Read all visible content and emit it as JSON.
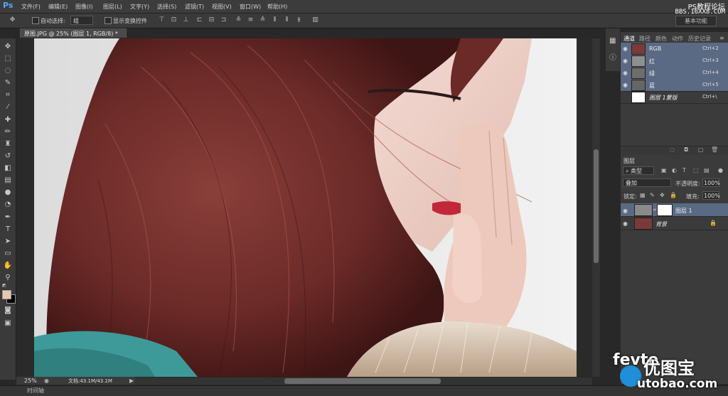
{
  "app": {
    "logo": "Ps"
  },
  "menu": [
    "文件(F)",
    "编辑(E)",
    "图像(I)",
    "图层(L)",
    "文字(Y)",
    "选择(S)",
    "滤镜(T)",
    "视图(V)",
    "窗口(W)",
    "帮助(H)"
  ],
  "site_watermark": {
    "line1": "PS教程论坛",
    "line2": "BBS.16XX8.COM"
  },
  "options": {
    "auto_select_label": "自动选择:",
    "auto_select_value": "组",
    "show_transform_label": "显示变换控件",
    "workspace_button": "基本功能"
  },
  "document": {
    "tab_title": "原图.JPG @ 25% (图层 1, RGB/8) *",
    "zoom": "25%",
    "size_info": "文档:43.1M/43.1M"
  },
  "timeline": {
    "label": "时间轴"
  },
  "channels": {
    "tabs": [
      "通道",
      "路径",
      "颜色",
      "动作",
      "历史记录"
    ],
    "rows": [
      {
        "name": "RGB",
        "shortcut": "Ctrl+2"
      },
      {
        "name": "红",
        "shortcut": "Ctrl+3"
      },
      {
        "name": "绿",
        "shortcut": "Ctrl+4"
      },
      {
        "name": "蓝",
        "shortcut": "Ctrl+5"
      },
      {
        "name": "图层 1蒙版",
        "shortcut": "Ctrl+\\"
      }
    ]
  },
  "layers": {
    "tab": "图层",
    "filter_type": "类型",
    "blend_mode": "叠加",
    "opacity_label": "不透明度:",
    "opacity_value": "100%",
    "lock_label": "锁定:",
    "fill_label": "填充:",
    "fill_value": "100%",
    "rows": [
      {
        "name": "图层 1"
      },
      {
        "name": "背景"
      }
    ]
  },
  "bottom_watermark": {
    "brand": "fevte",
    "cn": "优图宝",
    "domain": "utobao.com"
  },
  "colors": {
    "foreground": "#e8c7b0",
    "background": "#000000",
    "selection": "#5a6a84"
  }
}
